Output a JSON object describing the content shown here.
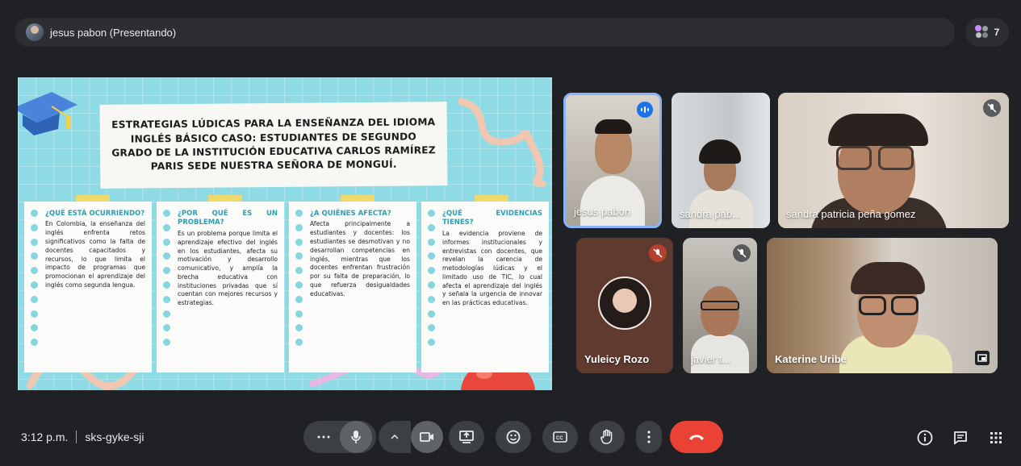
{
  "presenter_bar": {
    "label": "jesus pabon (Presentando)"
  },
  "participant_count": "7",
  "slide": {
    "title": "Estrategias lúdicas para la enseñanza del idioma inglés básico caso: Estudiantes de segundo grado de la Institución Educativa Carlos Ramírez Paris Sede Nuestra Señora de Monguí.",
    "cards": [
      {
        "heading": "¿Qué está ocurriendo?",
        "body": "En Colombia, la enseñanza del inglés enfrenta retos significativos como la falta de docentes capacitados y recursos, lo que limita el impacto de programas que promocionan el aprendizaje del inglés como segunda lengua."
      },
      {
        "heading": "¿Por qué es un problema?",
        "body": "Es un problema porque limita el aprendizaje efectivo del inglés en los estudiantes, afecta su motivación y desarrollo comunicativo, y amplía la brecha educativa con instituciones privadas que sí cuentan con mejores recursos y estrategias."
      },
      {
        "heading": "¿A quiénes afecta?",
        "body": "Afecta principalmente a estudiantes y docentes: los estudiantes se desmotivan y no desarrollan competencias en inglés, mientras que los docentes enfrentan frustración por su falta de preparación, lo que refuerza desigualdades educativas."
      },
      {
        "heading": "¿Qué evidencias tienes?",
        "body": "La evidencia proviene de informes institucionales y entrevistas con docentes, que revelan la carencia de metodologías lúdicas y el limitado uso de TIC, lo cual afecta el aprendizaje del inglés y señala la urgencia de innovar en las prácticas educativas."
      }
    ]
  },
  "tiles": [
    {
      "name": "jesus pabon"
    },
    {
      "name": "sandra pab..."
    },
    {
      "name": "sandra patricia peña gomez"
    },
    {
      "name": "Yuleicy Rozo"
    },
    {
      "name": "javier t..."
    },
    {
      "name": "Katerine Uribe"
    }
  ],
  "meeting": {
    "time": "3:12 p.m.",
    "code": "sks-gyke-sji"
  },
  "colors": {
    "end_call": "#ea4335",
    "speaking_border": "#8ab4f8",
    "slide_bg": "#8fdbe5"
  }
}
